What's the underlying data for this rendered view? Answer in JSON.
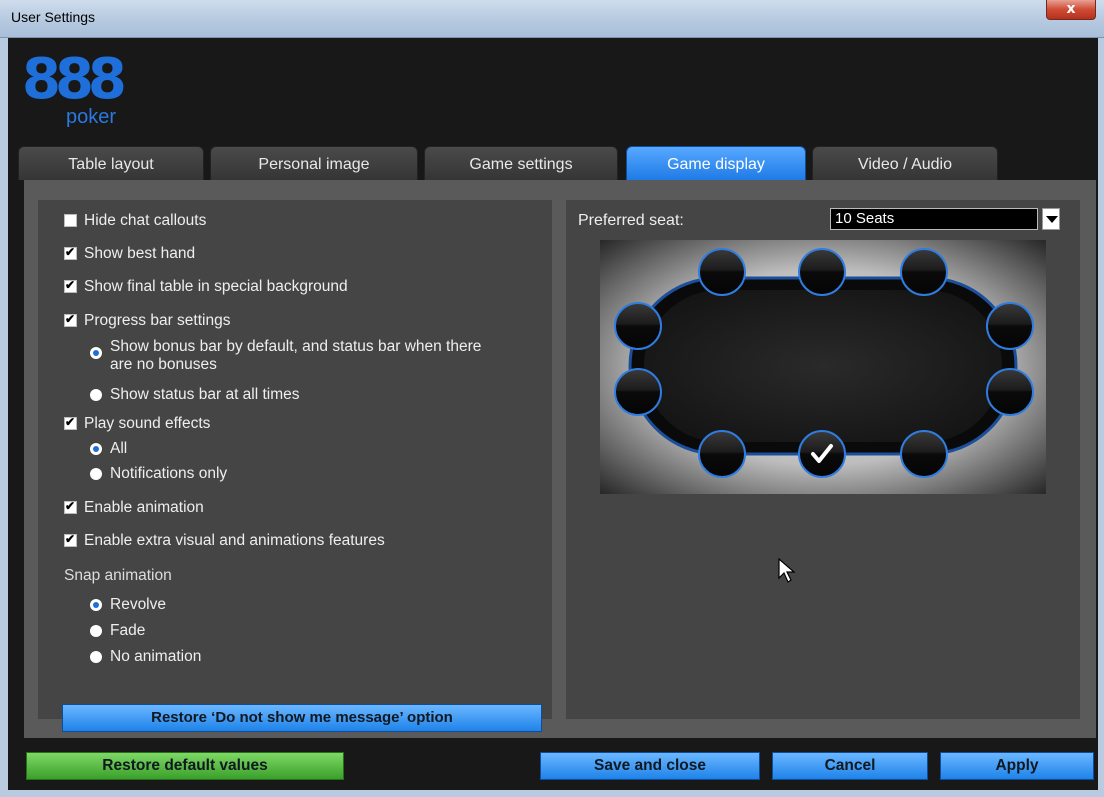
{
  "window": {
    "title": "User Settings",
    "close_glyph": "x"
  },
  "logo": {
    "digits": "888",
    "sub": "poker",
    "color": "#1e6fd9"
  },
  "tabs": [
    {
      "label": "Table layout",
      "active": false
    },
    {
      "label": "Personal image",
      "active": false
    },
    {
      "label": "Game settings",
      "active": false
    },
    {
      "label": "Game display",
      "active": true
    },
    {
      "label": "Video / Audio",
      "active": false
    }
  ],
  "options": {
    "hide_chat": {
      "label": "Hide chat callouts",
      "checked": false
    },
    "best_hand": {
      "label": "Show best hand",
      "checked": true
    },
    "final_table": {
      "label": "Show final table in special background",
      "checked": true
    },
    "progress_bar": {
      "label": "Progress bar settings",
      "checked": true
    },
    "progress_bonus": {
      "line1": "Show bonus bar by default, and status bar when there",
      "line2": "are no bonuses",
      "selected": true
    },
    "progress_status": {
      "label": "Show status bar at all times",
      "selected": false
    },
    "sound": {
      "label": "Play sound effects",
      "checked": true
    },
    "sound_all": {
      "label": "All",
      "selected": true
    },
    "sound_notif": {
      "label": "Notifications only",
      "selected": false
    },
    "animation": {
      "label": "Enable animation",
      "checked": true
    },
    "extra_visual": {
      "label": "Enable extra visual and animations features",
      "checked": true
    },
    "snap_heading": "Snap animation",
    "snap_revolve": {
      "label": "Revolve",
      "selected": true
    },
    "snap_fade": {
      "label": "Fade",
      "selected": false
    },
    "snap_none": {
      "label": "No animation",
      "selected": false
    }
  },
  "restore_message_button": "Restore ‘Do not show me message’ option",
  "seat": {
    "label": "Preferred seat:",
    "selected": "10 Seats",
    "seats_count": 10,
    "preferred_seat": "bottom-middle"
  },
  "buttons": {
    "restore_defaults": "Restore default values",
    "save_close": "Save and close",
    "cancel": "Cancel",
    "apply": "Apply"
  }
}
